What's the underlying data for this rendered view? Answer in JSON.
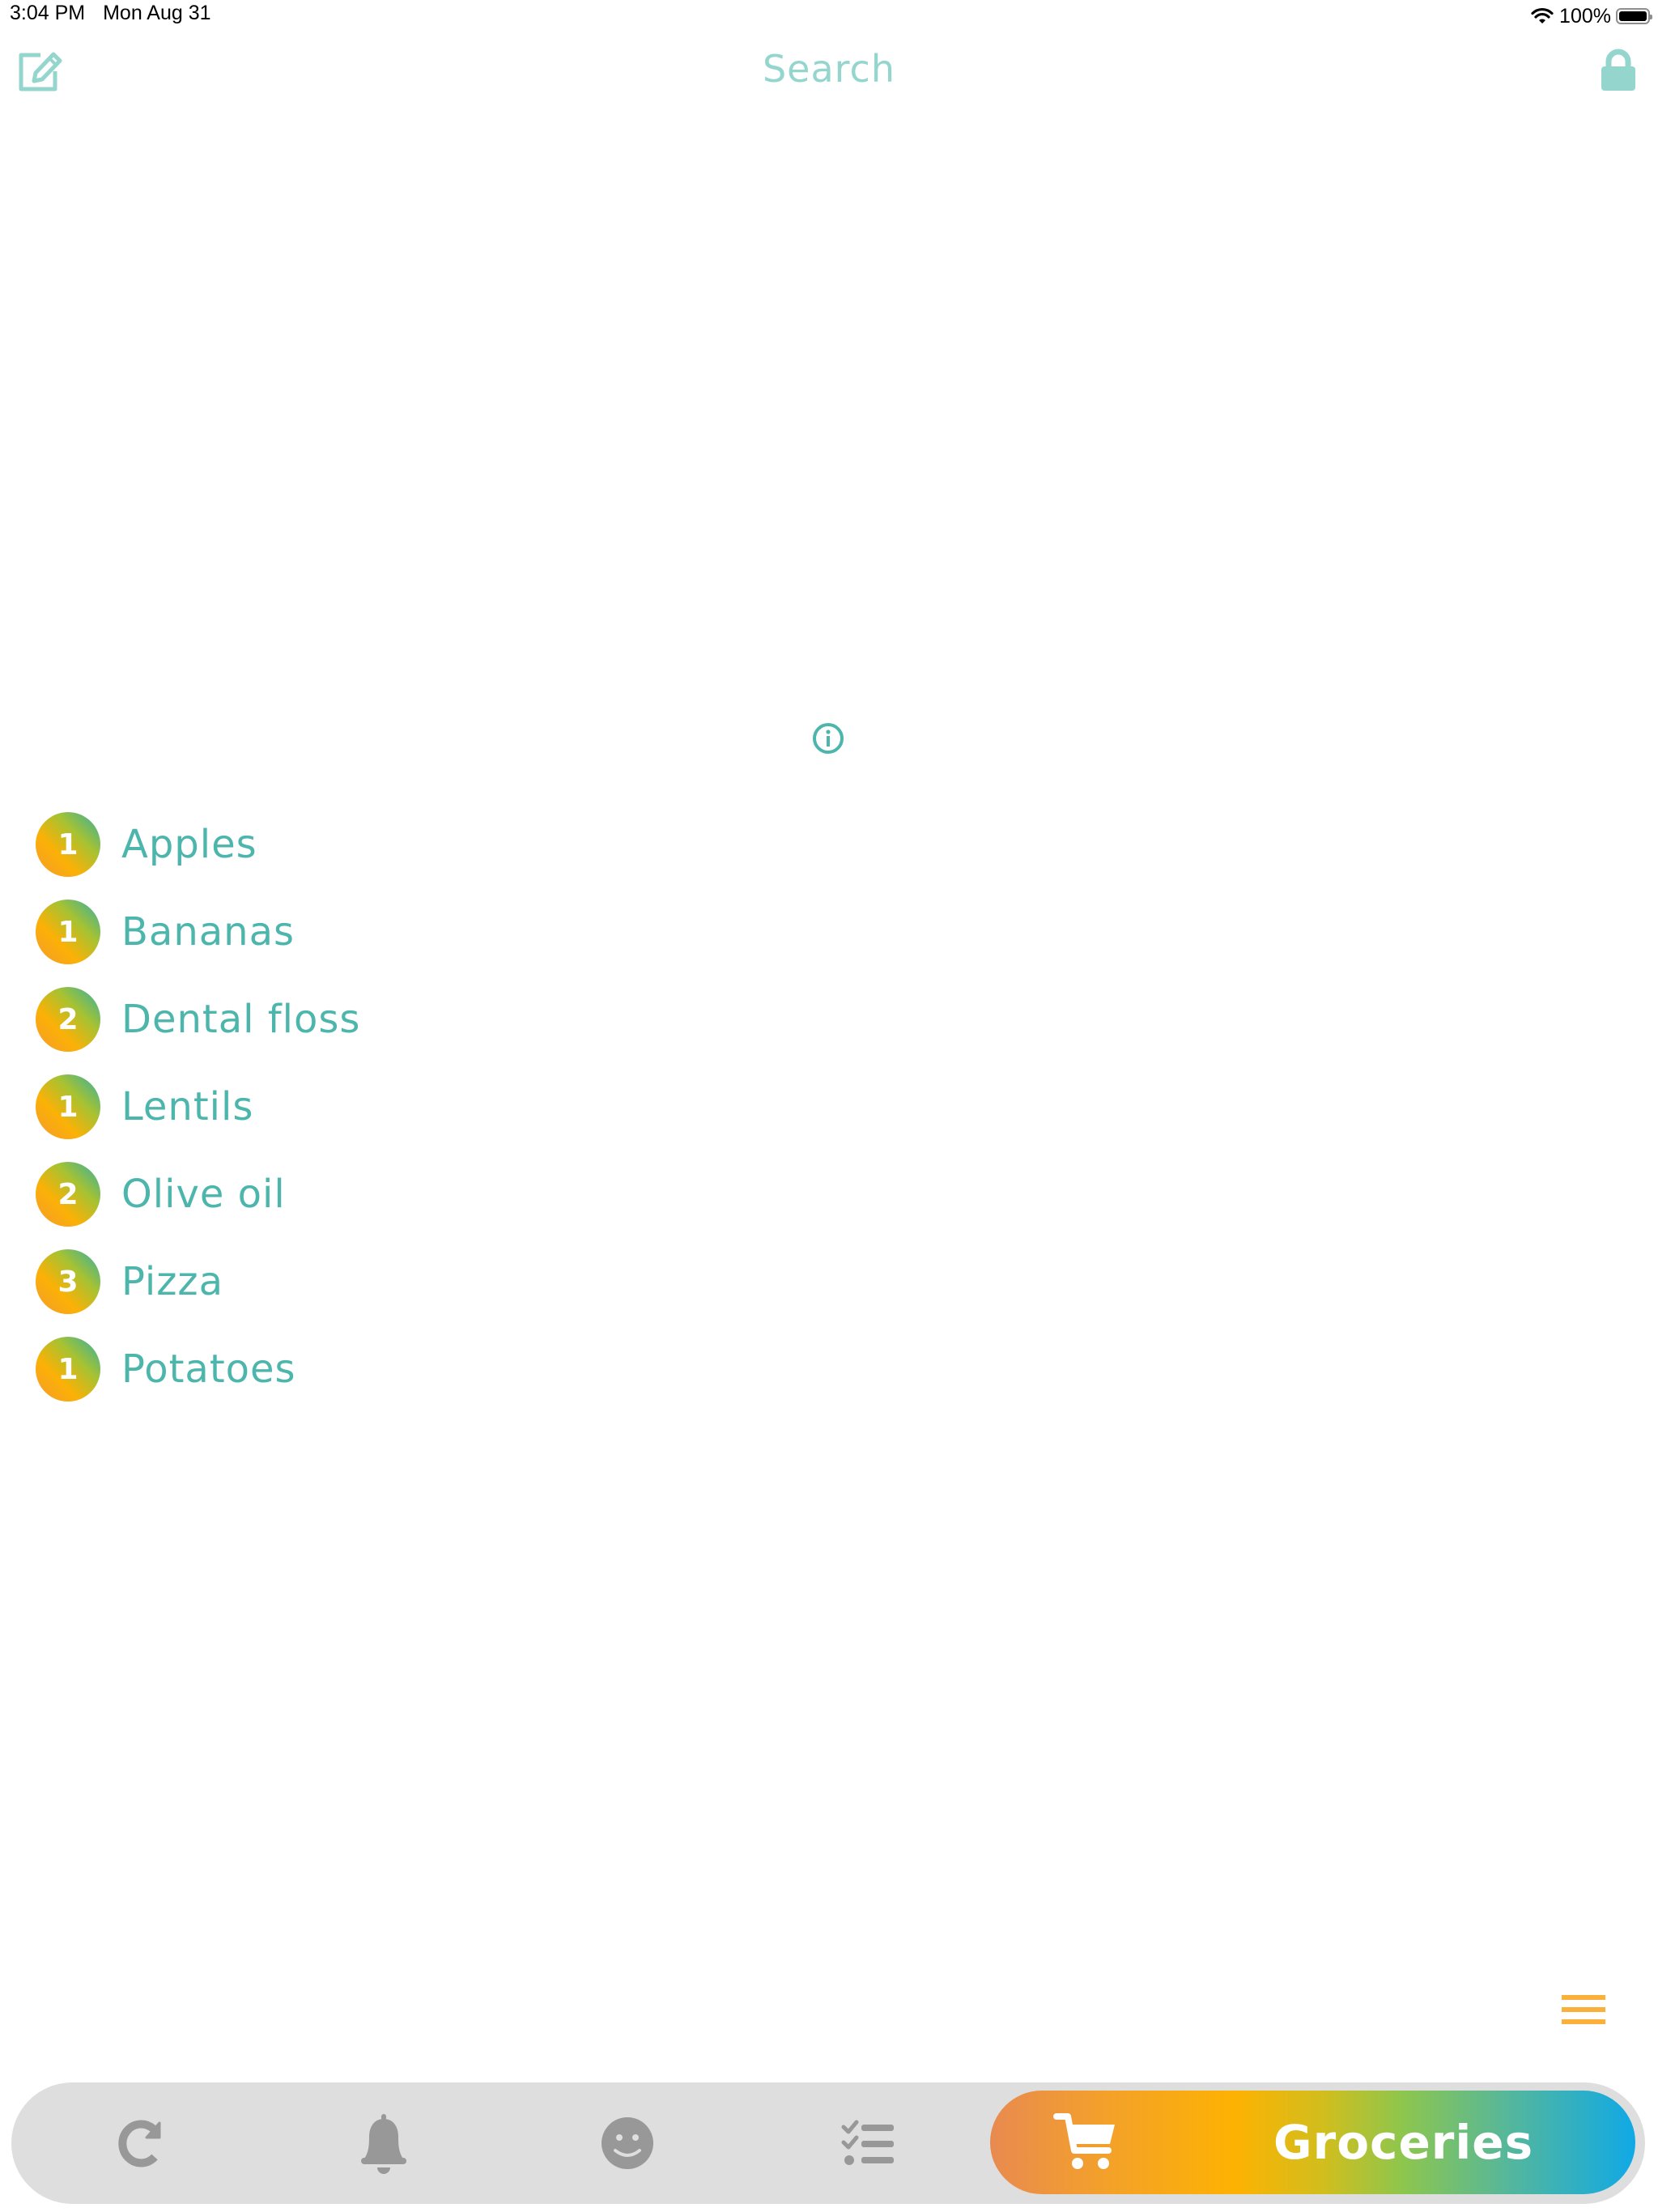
{
  "status_bar": {
    "time": "3:04 PM",
    "date": "Mon Aug 31",
    "battery": "100%",
    "battery_level": 1.0
  },
  "nav": {
    "title": "Search",
    "left_icon": "compose-icon",
    "right_icon": "lock-icon"
  },
  "info_icon": "info-icon",
  "items": [
    {
      "count": "1",
      "name": "Apples"
    },
    {
      "count": "1",
      "name": "Bananas"
    },
    {
      "count": "2",
      "name": "Dental floss"
    },
    {
      "count": "1",
      "name": "Lentils"
    },
    {
      "count": "2",
      "name": "Olive oil"
    },
    {
      "count": "3",
      "name": "Pizza"
    },
    {
      "count": "1",
      "name": "Potatoes"
    }
  ],
  "menu_icon": "hamburger-icon",
  "tabbar": {
    "tabs": [
      {
        "icon": "refresh-icon"
      },
      {
        "icon": "bell-icon"
      },
      {
        "icon": "smiley-icon"
      },
      {
        "icon": "checklist-icon"
      }
    ],
    "active": {
      "icon": "cart-icon",
      "label": "Groceries"
    }
  },
  "colors": {
    "accent": "#4DB6AC",
    "nav_accent": "#94D6CE",
    "menu": "#FBB03B",
    "tab_icon": "#989898",
    "tabbar_bg": "#DEDEDE"
  }
}
